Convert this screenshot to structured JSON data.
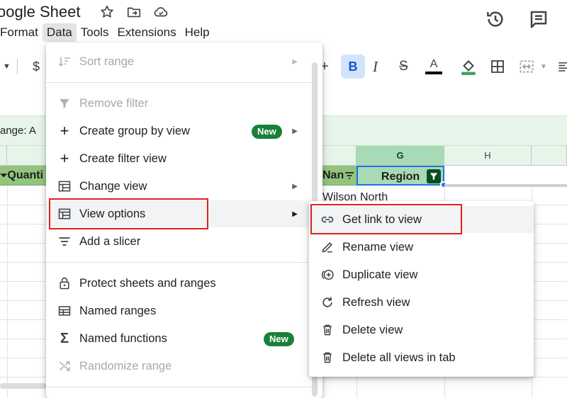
{
  "app": {
    "title": "oogle Sheet"
  },
  "menubar": [
    "Format",
    "Data",
    "Tools",
    "Extensions",
    "Help"
  ],
  "toolbar": {
    "currency": "$"
  },
  "filter_bar": {
    "label": "ange:  A"
  },
  "columns": {
    "g": "G",
    "h": "H"
  },
  "header_row": {
    "quantity": "Quanti",
    "name": "Nan",
    "region": "Region"
  },
  "row1": {
    "name": "Wilson",
    "region": "North"
  },
  "data_menu": {
    "sort_range": "Sort range",
    "remove_filter": "Remove filter",
    "create_group_by_view": "Create group by view",
    "create_filter_view": "Create filter view",
    "change_view": "Change view",
    "view_options": "View options",
    "add_slicer": "Add a slicer",
    "protect_sheets": "Protect sheets and ranges",
    "named_ranges": "Named ranges",
    "named_functions": "Named functions",
    "randomize_range": "Randomize range",
    "new_badge": "New"
  },
  "view_options_menu": {
    "get_link": "Get link to view",
    "rename": "Rename view",
    "duplicate": "Duplicate view",
    "refresh": "Refresh view",
    "delete": "Delete view",
    "delete_all": "Delete all views in tab"
  },
  "colors": {
    "accent_blue": "#0b57d0",
    "new_badge": "#188038",
    "highlight_box": "#e0211b",
    "header_fill": "#93c47d",
    "filter_bar": "#e6f4ea"
  }
}
